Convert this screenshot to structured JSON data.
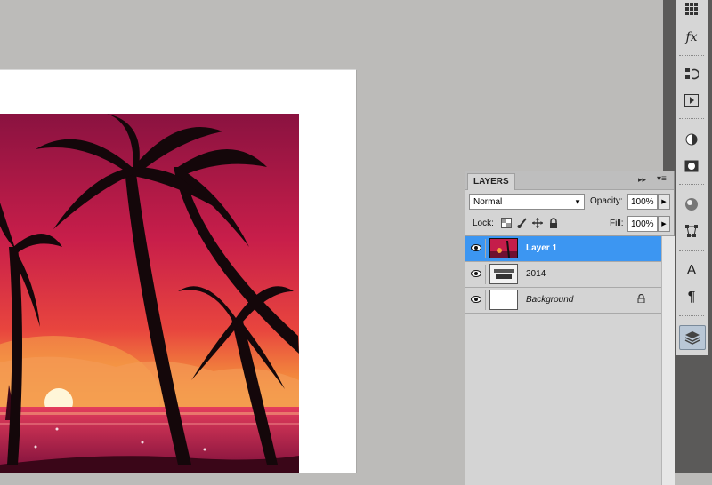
{
  "panel": {
    "tab_label": "LAYERS",
    "blend_mode": "Normal",
    "opacity_label": "Opacity:",
    "opacity_value": "100%",
    "lock_label": "Lock:",
    "fill_label": "Fill:",
    "fill_value": "100%",
    "layers": [
      {
        "name": "Layer 1",
        "visible": true,
        "selected": true
      },
      {
        "name": "2014",
        "visible": true,
        "selected": false
      },
      {
        "name": "Background",
        "visible": true,
        "selected": false,
        "locked": true
      }
    ]
  },
  "dock": {
    "icons": [
      "swatches-grid-icon",
      "fx-styles-icon",
      "history-icon",
      "actions-play-icon",
      "adjustments-icon",
      "masks-icon",
      "3d-icon",
      "transform-icon",
      "character-icon",
      "paragraph-icon",
      "layers-icon"
    ],
    "character_glyph": "A",
    "paragraph_glyph": "¶",
    "fx_glyph": "fx"
  },
  "colors": {
    "selection": "#3c96f2",
    "workspace": "#bcbbb9",
    "sunset_top": "#8a1240",
    "sunset_bottom": "#f6a13c"
  }
}
